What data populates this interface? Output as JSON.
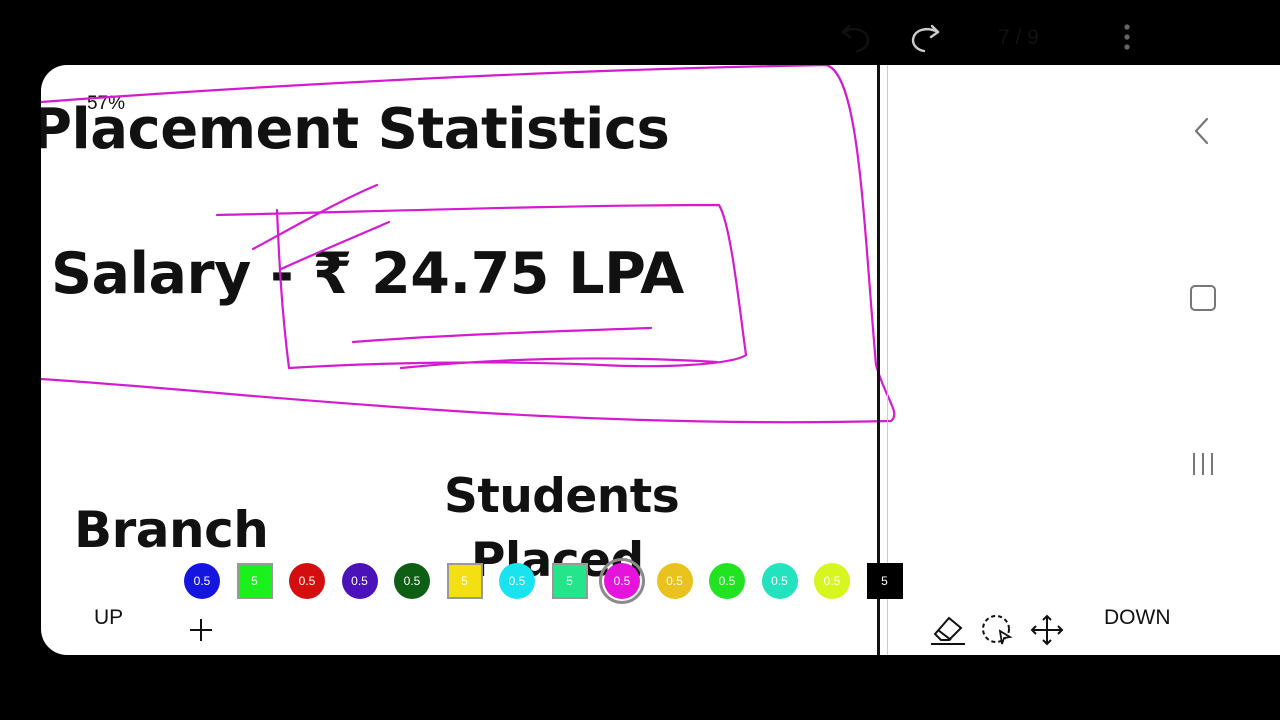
{
  "zoom_level": "57%",
  "slide": {
    "title": "Placement Statistics",
    "salary": "Salary - ₹ 24.75 LPA",
    "branch_header": "Branch",
    "students_header_line1": "Students",
    "students_header_line2": "Placed"
  },
  "toolbar": {
    "page_indicator": "7 / 9",
    "up_label": "UP",
    "down_label": "DOWN"
  },
  "ink_color": "#D51BD0",
  "palette": [
    {
      "label": "0.5",
      "color": "#1515E0",
      "shape": "circle"
    },
    {
      "label": "5",
      "color": "#19F01C",
      "shape": "square"
    },
    {
      "label": "0.5",
      "color": "#D40E0E",
      "shape": "circle"
    },
    {
      "label": "0.5",
      "color": "#4A12B8",
      "shape": "circle"
    },
    {
      "label": "0.5",
      "color": "#0E5E14",
      "shape": "circle"
    },
    {
      "label": "5",
      "color": "#F3E013",
      "shape": "square"
    },
    {
      "label": "0.5",
      "color": "#19E3EE",
      "shape": "circle"
    },
    {
      "label": "5",
      "color": "#24E58A",
      "shape": "square"
    },
    {
      "label": "0.5",
      "color": "#E513DC",
      "shape": "circle",
      "selected": true
    },
    {
      "label": "0.5",
      "color": "#E9C21E",
      "shape": "circle"
    },
    {
      "label": "0.5",
      "color": "#22E322",
      "shape": "circle"
    },
    {
      "label": "0.5",
      "color": "#22E3BE",
      "shape": "circle"
    },
    {
      "label": "0.5",
      "color": "#D7F51F",
      "shape": "circle"
    },
    {
      "label": "5",
      "color": "#000000",
      "shape": "square-black"
    }
  ]
}
